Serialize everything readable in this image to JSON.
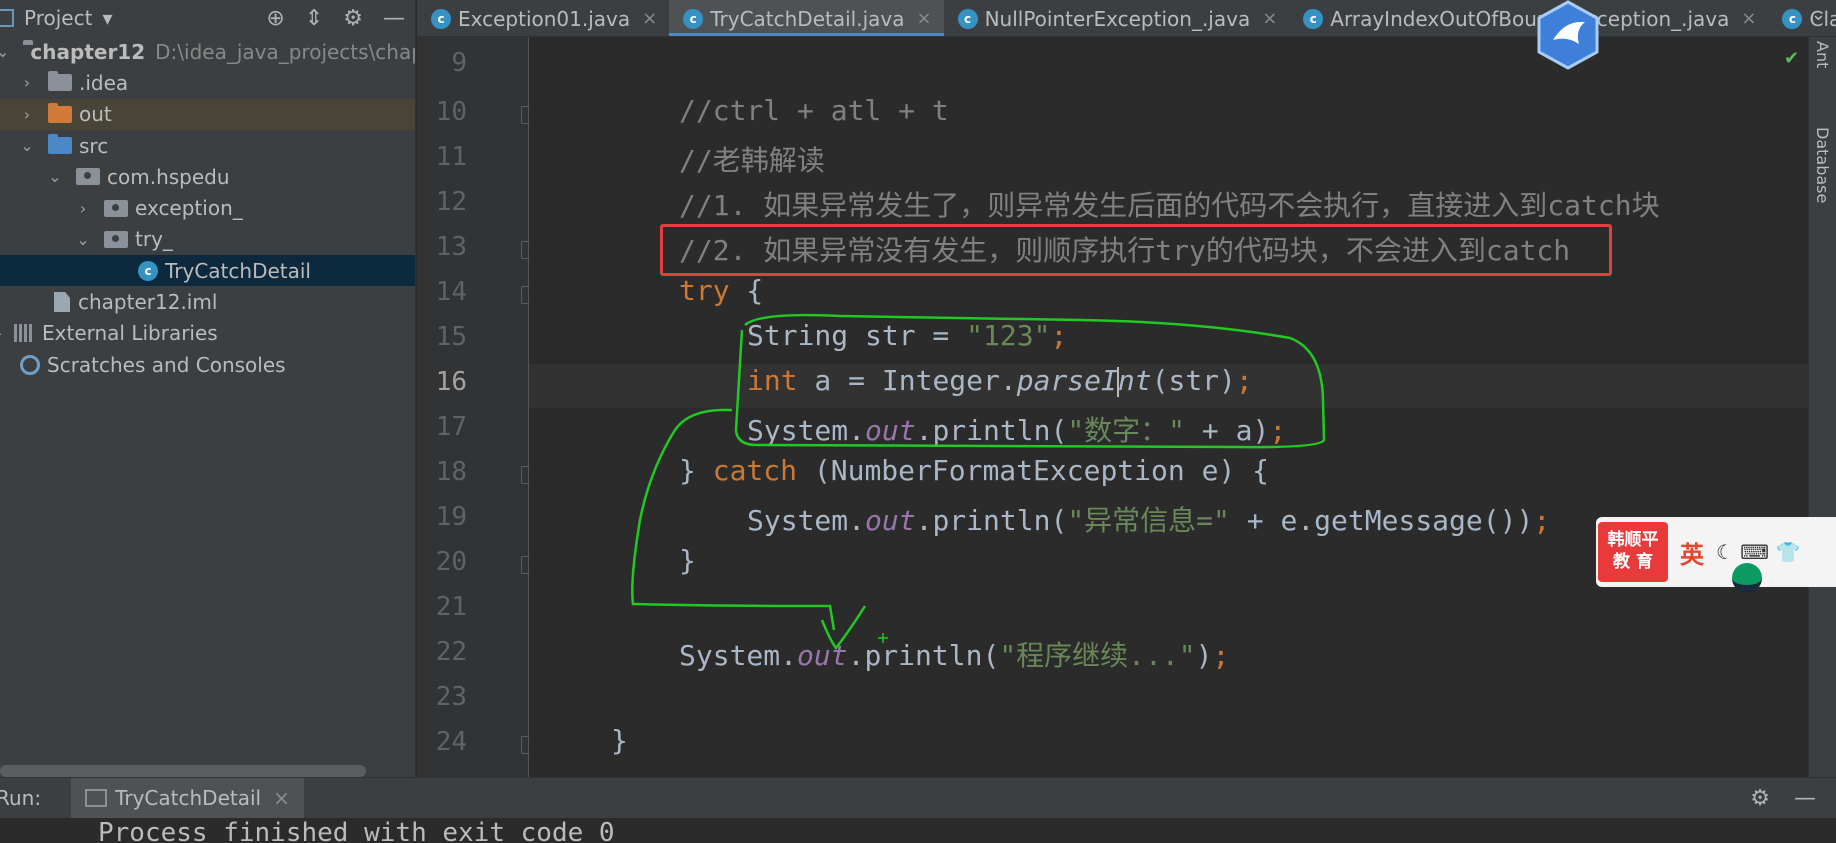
{
  "sidebar": {
    "title": "Project",
    "tree": [
      {
        "label": "chapter12",
        "path": "D:\\idea_java_projects\\chapt"
      },
      {
        "label": ".idea"
      },
      {
        "label": "out"
      },
      {
        "label": "src"
      },
      {
        "label": "com.hspedu"
      },
      {
        "label": "exception_"
      },
      {
        "label": "try_"
      },
      {
        "label": "TryCatchDetail"
      },
      {
        "label": "chapter12.iml"
      },
      {
        "label": "External Libraries"
      },
      {
        "label": "Scratches and Consoles"
      }
    ]
  },
  "tabs": [
    {
      "label": "Exception01.java"
    },
    {
      "label": "TryCatchDetail.java"
    },
    {
      "label": "NullPointerException_.java"
    },
    {
      "label": "ArrayIndexOutOfBoundsException_.java"
    },
    {
      "label": "Clas"
    }
  ],
  "editor": {
    "line_numbers": [
      "9",
      "10",
      "11",
      "12",
      "13",
      "14",
      "15",
      "16",
      "17",
      "18",
      "19",
      "20",
      "21",
      "22",
      "23",
      "24"
    ],
    "current_line": "16",
    "code": {
      "l10": "//ctrl + atl + t",
      "l11": "//老韩解读",
      "l12": "//1. 如果异常发生了，则异常发生后面的代码不会执行，直接进入到catch块",
      "l13": "//2. 如果异常没有发生，则顺序执行try的代码块，不会进入到catch",
      "l14_kw": "try",
      "l14_rest": " {",
      "l15_a": "String str = ",
      "l15_str": "\"123\"",
      "l15_semi": ";",
      "l16_kw": "int",
      "l16_a": " a = Integer.",
      "l16_call_a": "parseI",
      "l16_call_b": "nt",
      "l16_b": "(str)",
      "l16_semi": ";",
      "l17_a": "System.",
      "l17_field": "out",
      "l17_b": ".println(",
      "l17_str": "\"数字：\"",
      "l17_c": " + a)",
      "l17_semi": ";",
      "l18_a": "} ",
      "l18_kw": "catch",
      "l18_b": " (NumberFormatException e) {",
      "l19_a": "System.",
      "l19_field": "out",
      "l19_b": ".println(",
      "l19_str": "\"异常信息=\"",
      "l19_c": " + e.getMessage())",
      "l19_semi": ";",
      "l20": "}",
      "l22_a": "System.",
      "l22_field": "out",
      "l22_b": ".println(",
      "l22_str": "\"程序继续...\"",
      "l22_c": ")",
      "l22_semi": ";",
      "l24": "}"
    }
  },
  "right_tool": {
    "ant": "Ant",
    "database": "Database"
  },
  "run_panel": {
    "label": "Run:",
    "tab": "TryCatchDetail",
    "console_line": "Process finished with exit code 0"
  },
  "ime": {
    "logo_line1": "韩顺平",
    "logo_line2": "教 育",
    "lang": "英",
    "icons": "☾ ⌨ 👕"
  },
  "colors": {
    "keyword": "#cc7832",
    "string": "#6a8759",
    "comment": "#808080",
    "static_field": "#9876aa",
    "highlight_box": "#e04040",
    "annotation": "#22c922"
  }
}
